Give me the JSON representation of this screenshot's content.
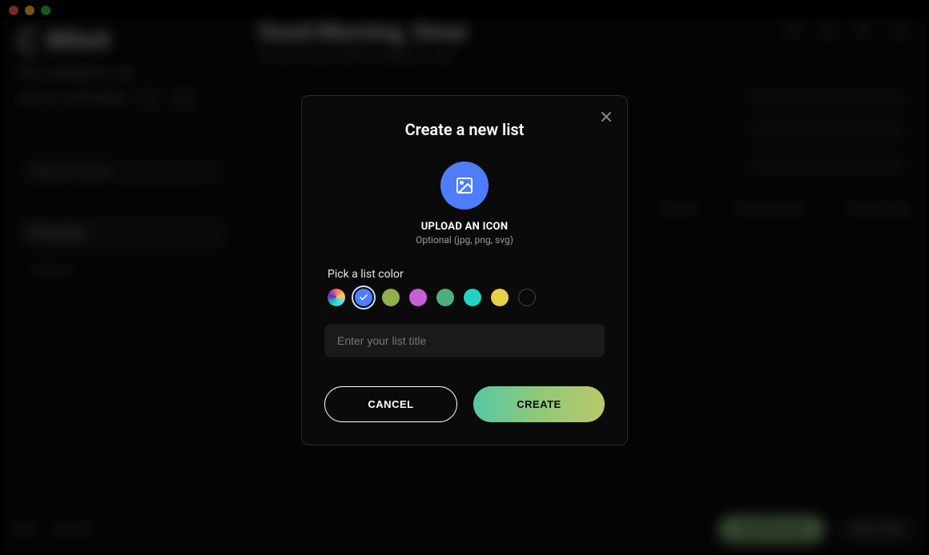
{
  "window": {
    "app_name": "Blitzit"
  },
  "sidebar": {
    "plan_label": "Plan: Unlimited For Life",
    "community_label": "Join our communities",
    "search_placeholder": "Search new List",
    "items": [
      {
        "label": "All my lists"
      },
      {
        "label": "Archived"
      }
    ]
  },
  "header": {
    "greeting": "Good Morning, Omar",
    "subtitle": "Are you ready to Blitz through your day?"
  },
  "filters": {
    "sort_label": "Sort by",
    "group_label": "Group by date",
    "drag_label": "Tap and drag"
  },
  "bottom": {
    "home_label": "HOME",
    "reports_label": "REPORTS",
    "add_task_label": "ADD NEW TASK",
    "settings_label": "Help Center"
  },
  "modal": {
    "title": "Create a new list",
    "upload_title": "UPLOAD AN ICON",
    "upload_subtitle": "Optional (jpg, png, svg)",
    "color_label": "Pick a list color",
    "list_title_placeholder": "Enter your list title",
    "cancel_label": "CANCEL",
    "create_label": "CREATE",
    "colors": [
      {
        "name": "rainbow",
        "hex": "conic"
      },
      {
        "name": "blue",
        "hex": "#4f7dff",
        "selected": true
      },
      {
        "name": "olive",
        "hex": "#8fb04a"
      },
      {
        "name": "magenta",
        "hex": "#c85ed8"
      },
      {
        "name": "green",
        "hex": "#4caf7d"
      },
      {
        "name": "cyan",
        "hex": "#22d3c5"
      },
      {
        "name": "yellow",
        "hex": "#e8cf4a"
      },
      {
        "name": "black",
        "hex": "#0a0a0a"
      }
    ]
  }
}
